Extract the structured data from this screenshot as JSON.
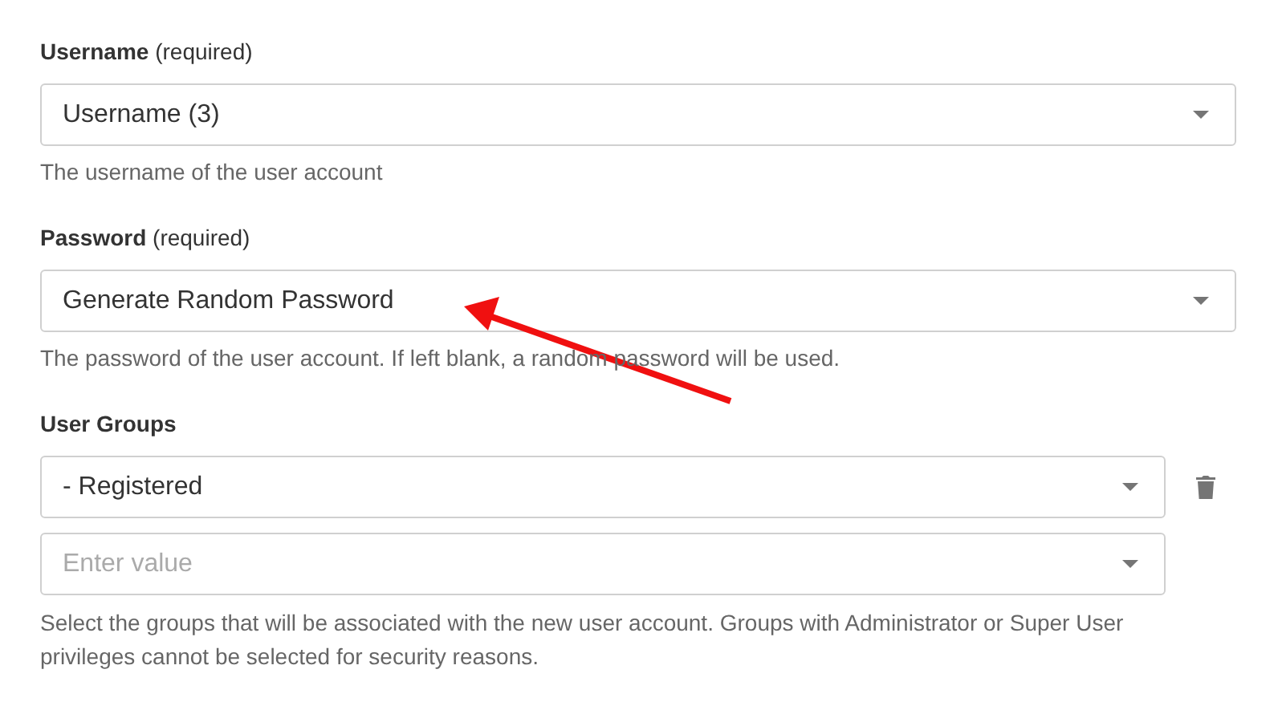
{
  "fields": [
    {
      "label": "Username",
      "note": "(required)",
      "value": "Username (3)",
      "help": "The username of the user account"
    },
    {
      "label": "Password",
      "note": "(required)",
      "value": "Generate Random Password",
      "help": "The password of the user account. If left blank, a random password will be used."
    }
  ],
  "groups": {
    "label": "User Groups",
    "rows": [
      {
        "value": "- Registered",
        "removable": true
      },
      {
        "placeholder": "Enter value",
        "removable": false
      }
    ],
    "help": "Select the groups that will be associated with the new user account. Groups with Administrator or Super User privileges cannot be selected for security reasons."
  },
  "annotation": {
    "kind": "arrow",
    "color": "#f01010"
  }
}
